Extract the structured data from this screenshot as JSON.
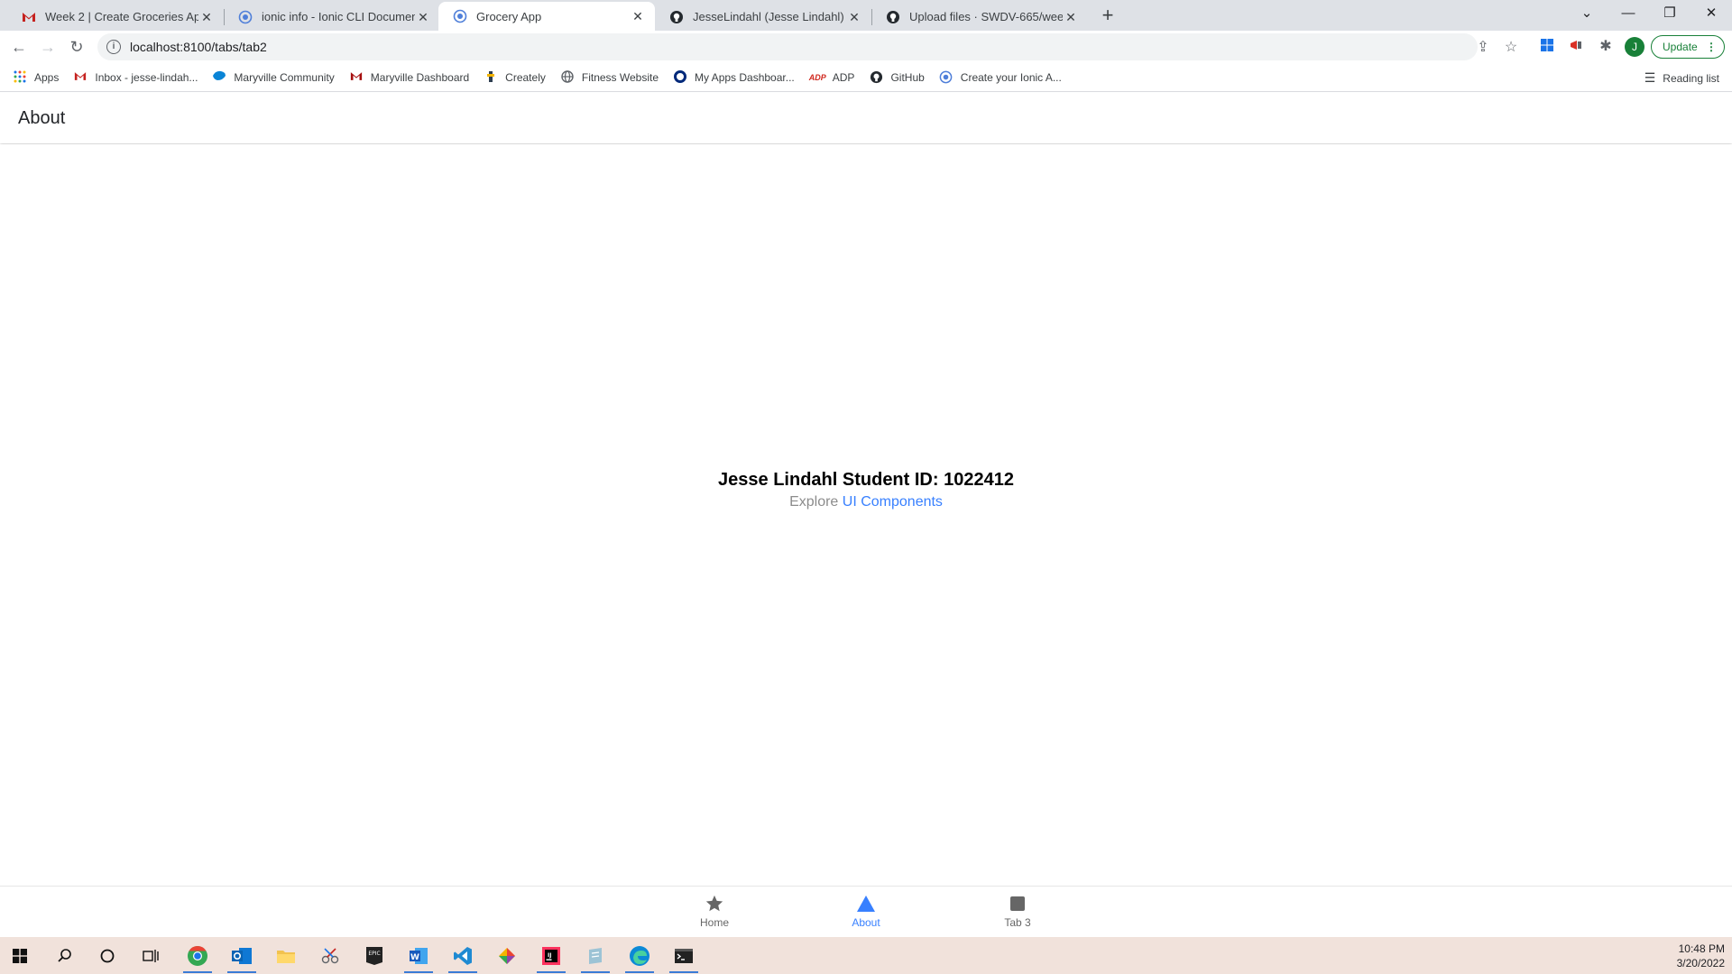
{
  "browser": {
    "tabs": [
      {
        "title": "Week 2 | Create Groceries App",
        "icon": "gmail-icon"
      },
      {
        "title": "ionic info - Ionic CLI Documentat",
        "icon": "ionic-icon"
      },
      {
        "title": "Grocery App",
        "icon": "ionic-icon",
        "active": true
      },
      {
        "title": "JesseLindahl (Jesse Lindahl)",
        "icon": "github-icon"
      },
      {
        "title": "Upload files · SWDV-665/week-2",
        "icon": "github-icon"
      }
    ],
    "new_tab_label": "+",
    "url": "localhost:8100/tabs/tab2",
    "avatar_letter": "J",
    "update_label": "Update",
    "bookmarks": [
      {
        "label": "Apps",
        "icon": "apps-grid-icon"
      },
      {
        "label": "Inbox - jesse-lindah...",
        "icon": "gmail-icon"
      },
      {
        "label": "Maryville Community",
        "icon": "maryville-icon"
      },
      {
        "label": "Maryville Dashboard",
        "icon": "gmail-icon"
      },
      {
        "label": "Creately",
        "icon": "creately-icon"
      },
      {
        "label": "Fitness Website",
        "icon": "globe-icon"
      },
      {
        "label": "My Apps Dashboar...",
        "icon": "okta-icon"
      },
      {
        "label": "ADP",
        "icon": "adp-icon"
      },
      {
        "label": "GitHub",
        "icon": "github-icon"
      },
      {
        "label": "Create your Ionic A...",
        "icon": "ionic-icon"
      }
    ],
    "reading_list_label": "Reading list"
  },
  "app": {
    "header_title": "About",
    "heading": "Jesse Lindahl Student ID: 1022412",
    "explore_prefix": "Explore",
    "explore_link": "UI Components",
    "tabs": [
      {
        "label": "Home",
        "icon": "star-icon"
      },
      {
        "label": "About",
        "icon": "triangle-icon",
        "selected": true
      },
      {
        "label": "Tab 3",
        "icon": "square-icon"
      }
    ],
    "accent_color": "#3880ff"
  },
  "taskbar": {
    "time": "10:48 PM",
    "date": "3/20/2022"
  }
}
